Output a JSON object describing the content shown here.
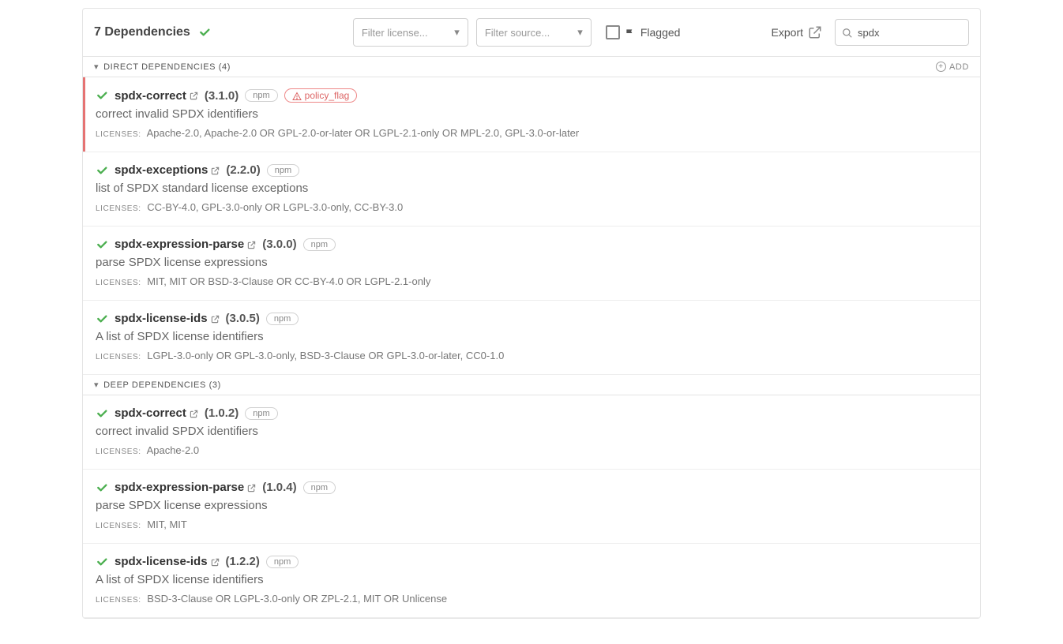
{
  "header": {
    "title": "7 Dependencies",
    "filter_license_placeholder": "Filter license...",
    "filter_source_placeholder": "Filter source...",
    "flagged_label": "Flagged",
    "export_label": "Export",
    "search_value": "spdx"
  },
  "sections": [
    {
      "title": "DIRECT DEPENDENCIES (4)",
      "add_label": "ADD",
      "items": [
        {
          "name": "spdx-correct",
          "version": "(3.1.0)",
          "source": "npm",
          "flagged": true,
          "flag_label": "policy_flag",
          "description": "correct invalid SPDX identifiers",
          "licenses": "Apache-2.0, Apache-2.0 OR GPL-2.0-or-later OR LGPL-2.1-only OR MPL-2.0, GPL-3.0-or-later"
        },
        {
          "name": "spdx-exceptions",
          "version": "(2.2.0)",
          "source": "npm",
          "flagged": false,
          "description": "list of SPDX standard license exceptions",
          "licenses": "CC-BY-4.0, GPL-3.0-only OR LGPL-3.0-only, CC-BY-3.0"
        },
        {
          "name": "spdx-expression-parse",
          "version": "(3.0.0)",
          "source": "npm",
          "flagged": false,
          "description": "parse SPDX license expressions",
          "licenses": "MIT, MIT OR BSD-3-Clause OR CC-BY-4.0 OR LGPL-2.1-only"
        },
        {
          "name": "spdx-license-ids",
          "version": "(3.0.5)",
          "source": "npm",
          "flagged": false,
          "description": "A list of SPDX license identifiers",
          "licenses": "LGPL-3.0-only OR GPL-3.0-only, BSD-3-Clause OR GPL-3.0-or-later, CC0-1.0"
        }
      ]
    },
    {
      "title": "DEEP DEPENDENCIES (3)",
      "items": [
        {
          "name": "spdx-correct",
          "version": "(1.0.2)",
          "source": "npm",
          "flagged": false,
          "description": "correct invalid SPDX identifiers",
          "licenses": "Apache-2.0"
        },
        {
          "name": "spdx-expression-parse",
          "version": "(1.0.4)",
          "source": "npm",
          "flagged": false,
          "description": "parse SPDX license expressions",
          "licenses": "MIT, MIT"
        },
        {
          "name": "spdx-license-ids",
          "version": "(1.2.2)",
          "source": "npm",
          "flagged": false,
          "description": "A list of SPDX license identifiers",
          "licenses": "BSD-3-Clause OR LGPL-3.0-only OR ZPL-2.1, MIT OR Unlicense"
        }
      ]
    }
  ],
  "licenses_label": "LICENSES:"
}
